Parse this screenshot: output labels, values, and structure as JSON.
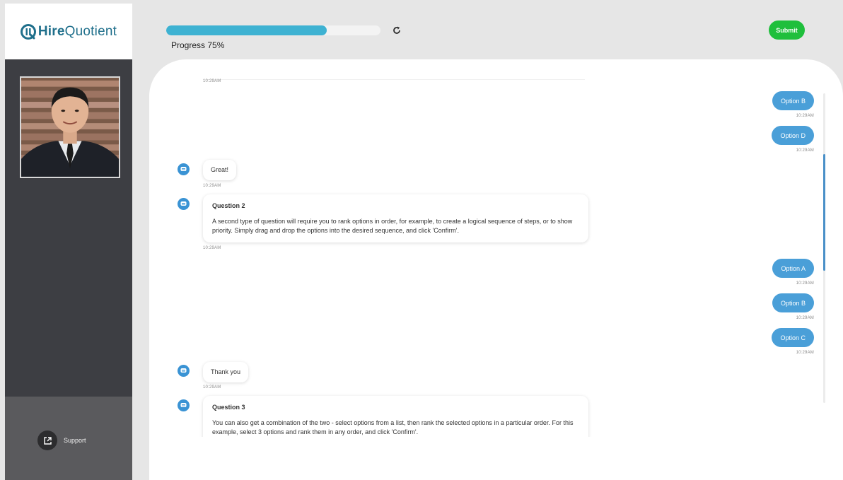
{
  "brand": {
    "name_bold": "Hire",
    "name_light": "Quotient"
  },
  "header": {
    "progress_label": "Progress 75%",
    "progress_value": 0.75,
    "submit_label": "Submit"
  },
  "sidebar": {
    "support_label": "Support"
  },
  "colors": {
    "accent_blue": "#3eb2d2",
    "user_bubble": "#4a9fd8",
    "submit_green": "#1fbf3c",
    "sidebar_dark": "#3d3e43"
  },
  "chat": {
    "messages": [
      {
        "sender": "bot",
        "time": "10:29AM"
      },
      {
        "sender": "user",
        "text": "Option B",
        "time": "10:29AM"
      },
      {
        "sender": "user",
        "text": "Option D",
        "time": "10:29AM"
      },
      {
        "sender": "bot",
        "text": "Great!",
        "time": "10:29AM"
      },
      {
        "sender": "bot",
        "title": "Question 2",
        "text": "A second type of question will require you to rank options in order, for example, to create a logical sequence of steps, or to show priority. Simply drag and drop the options into the desired sequence, and click 'Confirm'.",
        "time": "10:29AM"
      },
      {
        "sender": "user",
        "text": "Option A",
        "time": "10:29AM"
      },
      {
        "sender": "user",
        "text": "Option B",
        "time": "10:29AM"
      },
      {
        "sender": "user",
        "text": "Option C",
        "time": "10:29AM"
      },
      {
        "sender": "bot",
        "text": "Thank you",
        "time": "10:29AM"
      },
      {
        "sender": "bot",
        "title": "Question 3",
        "text": "You can also get a combination of the two - select options from a list, then rank the selected options in a particular order. For this example, select 3 options and rank them in any order, and click 'Confirm'."
      }
    ]
  },
  "icons": {
    "refresh": "refresh-icon",
    "support": "external-link-icon",
    "bot": "chat-bot-icon"
  }
}
